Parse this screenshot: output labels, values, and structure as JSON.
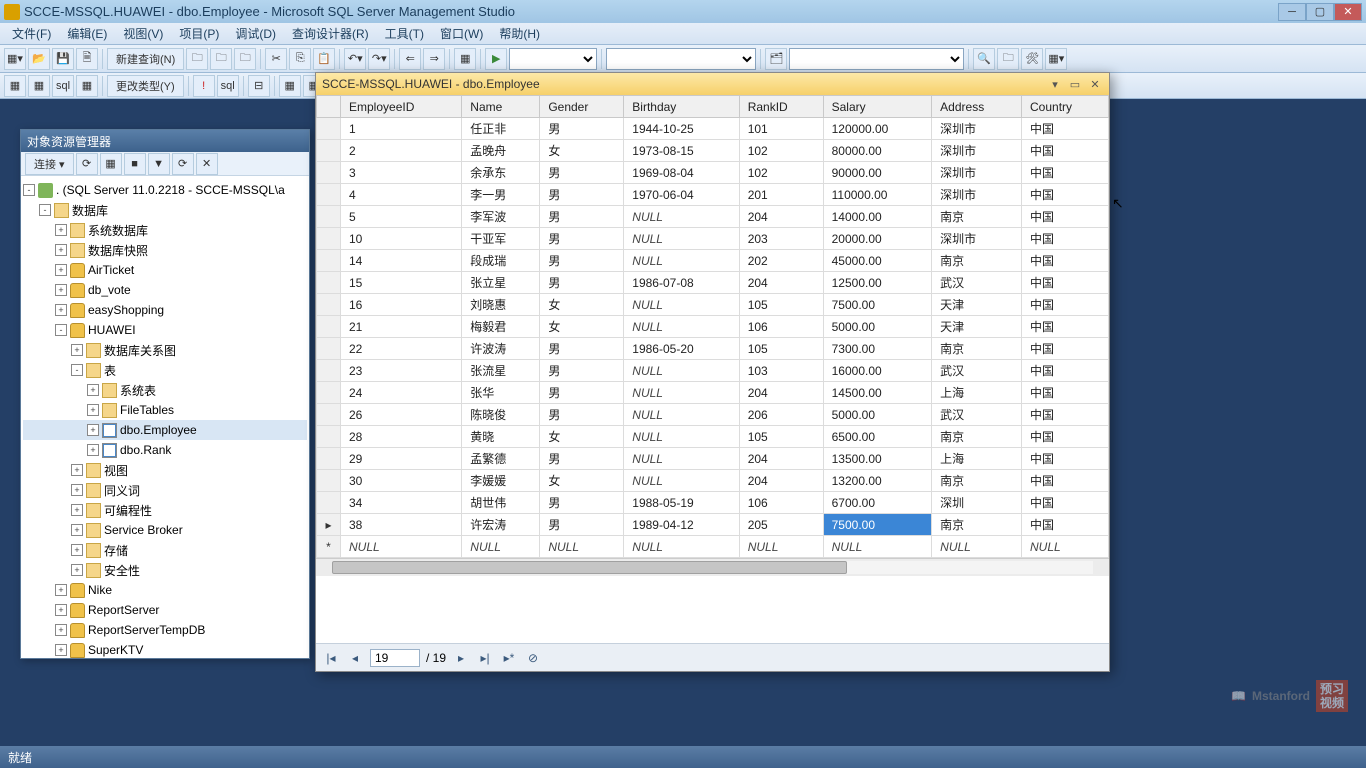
{
  "window": {
    "title": "SCCE-MSSQL.HUAWEI - dbo.Employee - Microsoft SQL Server Management Studio"
  },
  "menu": [
    "文件(F)",
    "编辑(E)",
    "视图(V)",
    "项目(P)",
    "调试(D)",
    "查询设计器(R)",
    "工具(T)",
    "窗口(W)",
    "帮助(H)"
  ],
  "toolbar1": {
    "new_query": "新建查询(N)"
  },
  "toolbar2": {
    "change_type": "更改类型(Y)"
  },
  "object_explorer": {
    "title": "对象资源管理器",
    "connect_label": "连接 ▾",
    "root": ". (SQL Server 11.0.2218 - SCCE-MSSQL\\a",
    "nodes": {
      "databases": "数据库",
      "sys_db": "系统数据库",
      "db_snapshot": "数据库快照",
      "dbs": [
        "AirTicket",
        "db_vote",
        "easyShopping",
        "HUAWEI",
        "Nike",
        "ReportServer",
        "ReportServerTempDB",
        "SuperKTV"
      ],
      "huawei_children": {
        "diagram": "数据库关系图",
        "tables": "表",
        "systables": "系统表",
        "filetables": "FileTables",
        "emp": "dbo.Employee",
        "rank": "dbo.Rank",
        "views": "视图",
        "synonyms": "同义词",
        "programmability": "可编程性",
        "service_broker": "Service Broker",
        "storage": "存储",
        "security": "安全性"
      }
    }
  },
  "document": {
    "title": "SCCE-MSSQL.HUAWEI - dbo.Employee",
    "columns": [
      "EmployeeID",
      "Name",
      "Gender",
      "Birthday",
      "RankID",
      "Salary",
      "Address",
      "Country"
    ],
    "rows": [
      [
        "1",
        "任正非",
        "男",
        "1944-10-25",
        "101",
        "120000.00",
        "深圳市",
        "中国"
      ],
      [
        "2",
        "孟晚舟",
        "女",
        "1973-08-15",
        "102",
        "80000.00",
        "深圳市",
        "中国"
      ],
      [
        "3",
        "余承东",
        "男",
        "1969-08-04",
        "102",
        "90000.00",
        "深圳市",
        "中国"
      ],
      [
        "4",
        "李一男",
        "男",
        "1970-06-04",
        "201",
        "110000.00",
        "深圳市",
        "中国"
      ],
      [
        "5",
        "李军波",
        "男",
        "NULL",
        "204",
        "14000.00",
        "南京",
        "中国"
      ],
      [
        "10",
        "干亚军",
        "男",
        "NULL",
        "203",
        "20000.00",
        "深圳市",
        "中国"
      ],
      [
        "14",
        "段成瑞",
        "男",
        "NULL",
        "202",
        "45000.00",
        "南京",
        "中国"
      ],
      [
        "15",
        "张立星",
        "男",
        "1986-07-08",
        "204",
        "12500.00",
        "武汉",
        "中国"
      ],
      [
        "16",
        "刘晓惠",
        "女",
        "NULL",
        "105",
        "7500.00",
        "天津",
        "中国"
      ],
      [
        "21",
        "梅毅君",
        "女",
        "NULL",
        "106",
        "5000.00",
        "天津",
        "中国"
      ],
      [
        "22",
        "许波涛",
        "男",
        "1986-05-20",
        "105",
        "7300.00",
        "南京",
        "中国"
      ],
      [
        "23",
        "张流星",
        "男",
        "NULL",
        "103",
        "16000.00",
        "武汉",
        "中国"
      ],
      [
        "24",
        "张华",
        "男",
        "NULL",
        "204",
        "14500.00",
        "上海",
        "中国"
      ],
      [
        "26",
        "陈晓俊",
        "男",
        "NULL",
        "206",
        "5000.00",
        "武汉",
        "中国"
      ],
      [
        "28",
        "黄晓",
        "女",
        "NULL",
        "105",
        "6500.00",
        "南京",
        "中国"
      ],
      [
        "29",
        "孟繁德",
        "男",
        "NULL",
        "204",
        "13500.00",
        "上海",
        "中国"
      ],
      [
        "30",
        "李媛媛",
        "女",
        "NULL",
        "204",
        "13200.00",
        "南京",
        "中国"
      ],
      [
        "34",
        "胡世伟",
        "男",
        "1988-05-19",
        "106",
        "6700.00",
        "深圳",
        "中国"
      ],
      [
        "38",
        "许宏涛",
        "男",
        "1989-04-12",
        "205",
        "7500.00",
        "南京",
        "中国"
      ]
    ],
    "selected_cell": {
      "row": 18,
      "col": 5
    },
    "nav": {
      "current": "19",
      "total": "/ 19"
    }
  },
  "statusbar": {
    "text": "就绪"
  },
  "watermark": {
    "text": "Mstanford",
    "badge1": "预习",
    "badge2": "视频"
  }
}
